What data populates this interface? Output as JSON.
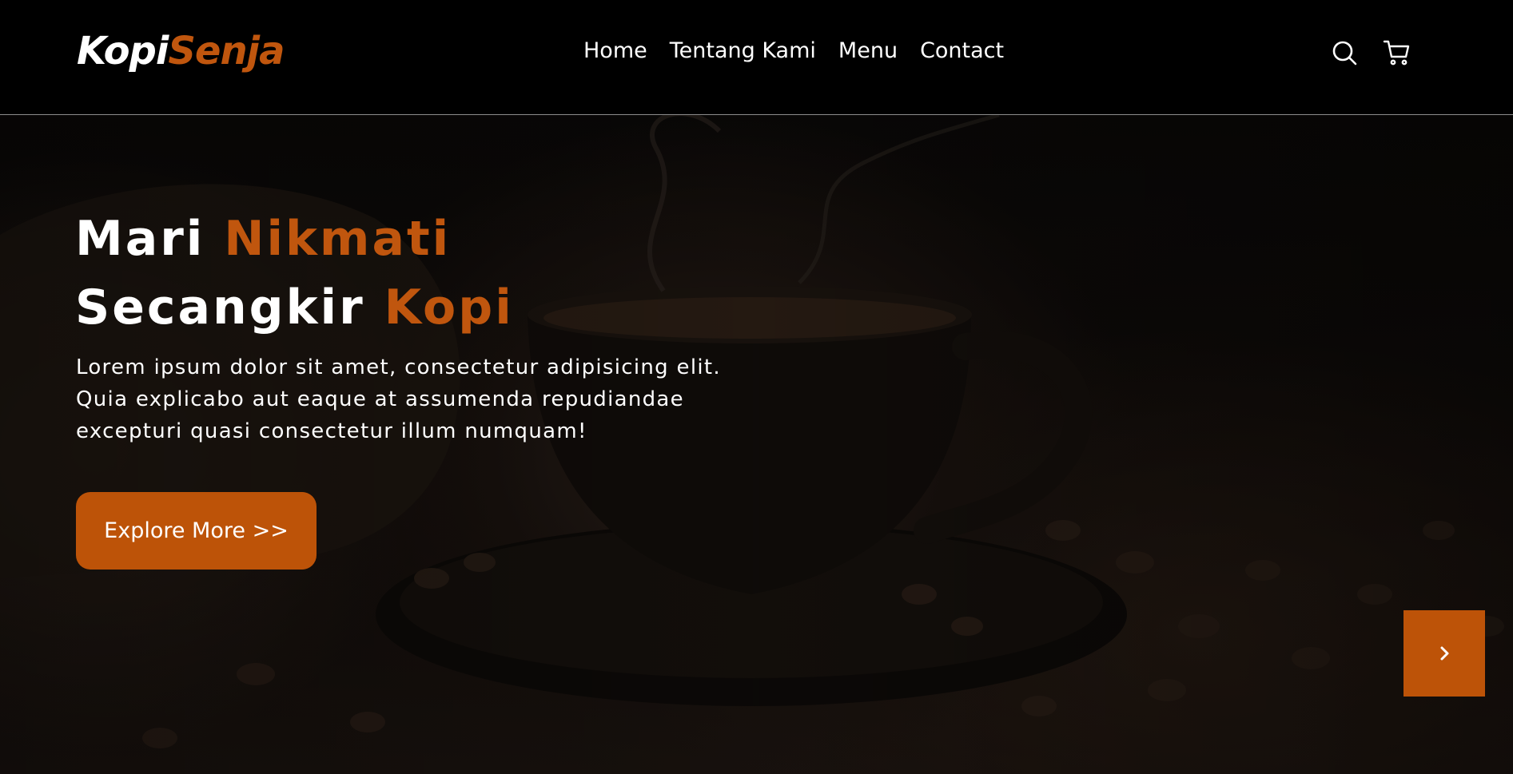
{
  "brand": {
    "logo_part1": "Kopi",
    "logo_part2": "Senja",
    "accent_color": "#bd5308"
  },
  "nav": {
    "links": [
      "Home",
      "Tentang Kami",
      "Menu",
      "Contact"
    ],
    "icons": [
      "search-icon",
      "shopping-cart-icon"
    ]
  },
  "hero": {
    "title_part1": "Mari",
    "title_part2": "Nikmati",
    "title_part3": "Secangkir",
    "title_part4": "Kopi",
    "description": "Lorem ipsum dolor sit amet, consectetur adipisicing elit. Quia explicabo aut eaque at assumenda repudiandae excepturi quasi consectetur illum numquam!",
    "cta_label": "Explore More >>",
    "next_icon": "chevron-right-icon"
  }
}
